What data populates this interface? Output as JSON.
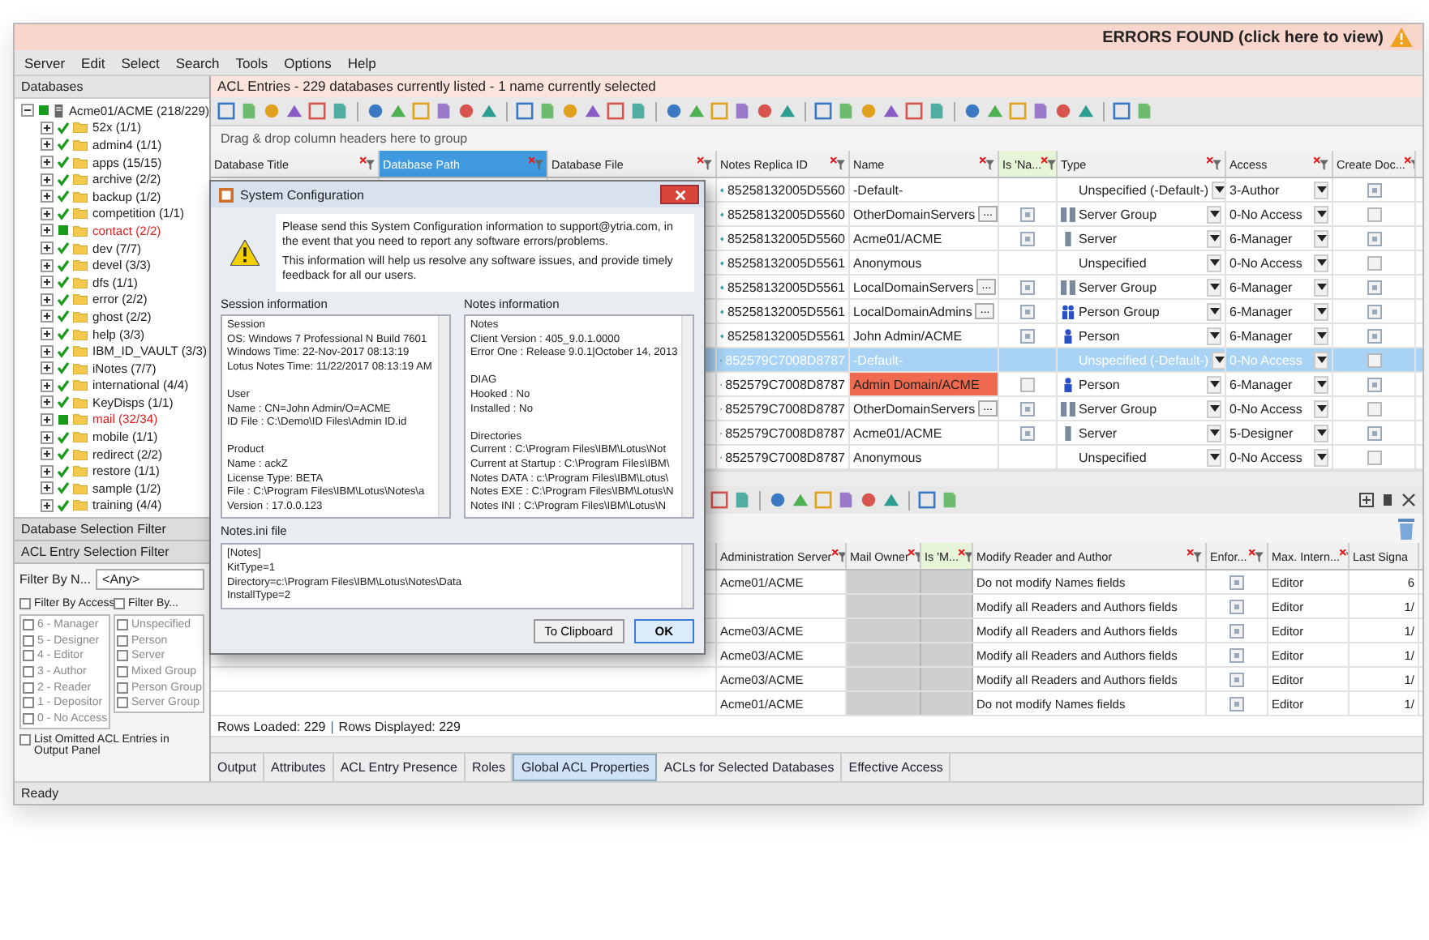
{
  "banner": {
    "text": "ERRORS FOUND (click here to view)"
  },
  "menu": [
    "Server",
    "Edit",
    "Select",
    "Search",
    "Tools",
    "Options",
    "Help"
  ],
  "databases_panel": {
    "title": "Databases",
    "tree": [
      {
        "label": "Acme01/ACME (218/229)",
        "checked": true,
        "partial": true,
        "error": false,
        "expanded": true,
        "children": [
          {
            "label": "52x (1/1)",
            "checked": true,
            "partial": false,
            "error": false,
            "expanded": false
          },
          {
            "label": "admin4 (1/1)",
            "checked": true,
            "partial": false,
            "error": false,
            "expanded": false
          },
          {
            "label": "apps (15/15)",
            "checked": true,
            "partial": false,
            "error": false,
            "expanded": false
          },
          {
            "label": "archive (2/2)",
            "checked": true,
            "partial": false,
            "error": false,
            "expanded": false
          },
          {
            "label": "backup (1/2)",
            "checked": true,
            "partial": false,
            "error": false,
            "expanded": false
          },
          {
            "label": "competition (1/1)",
            "checked": true,
            "partial": false,
            "error": false,
            "expanded": false
          },
          {
            "label": "contact (2/2)",
            "checked": true,
            "partial": true,
            "error": true,
            "expanded": false
          },
          {
            "label": "dev (7/7)",
            "checked": true,
            "partial": false,
            "error": false,
            "expanded": false
          },
          {
            "label": "devel (3/3)",
            "checked": true,
            "partial": false,
            "error": false,
            "expanded": false
          },
          {
            "label": "dfs (1/1)",
            "checked": true,
            "partial": false,
            "error": false,
            "expanded": false
          },
          {
            "label": "error (2/2)",
            "checked": true,
            "partial": false,
            "error": false,
            "expanded": false
          },
          {
            "label": "ghost (2/2)",
            "checked": true,
            "partial": false,
            "error": false,
            "expanded": false
          },
          {
            "label": "help (3/3)",
            "checked": true,
            "partial": false,
            "error": false,
            "expanded": false
          },
          {
            "label": "IBM_ID_VAULT (3/3)",
            "checked": true,
            "partial": false,
            "error": false,
            "expanded": false
          },
          {
            "label": "iNotes (7/7)",
            "checked": true,
            "partial": false,
            "error": false,
            "expanded": false
          },
          {
            "label": "international (4/4)",
            "checked": true,
            "partial": false,
            "error": false,
            "expanded": false
          },
          {
            "label": "KeyDisps (1/1)",
            "checked": true,
            "partial": false,
            "error": false,
            "expanded": false
          },
          {
            "label": "mail (32/34)",
            "checked": true,
            "partial": true,
            "error": true,
            "expanded": false
          },
          {
            "label": "mobile (1/1)",
            "checked": true,
            "partial": false,
            "error": false,
            "expanded": false
          },
          {
            "label": "redirect (2/2)",
            "checked": true,
            "partial": false,
            "error": false,
            "expanded": false
          },
          {
            "label": "restore (1/1)",
            "checked": true,
            "partial": false,
            "error": false,
            "expanded": false
          },
          {
            "label": "sample (1/2)",
            "checked": true,
            "partial": false,
            "error": false,
            "expanded": false
          },
          {
            "label": "training (4/4)",
            "checked": true,
            "partial": false,
            "error": false,
            "expanded": false
          }
        ]
      }
    ]
  },
  "filters": {
    "database_filter": "Database Selection Filter",
    "acl_filter": "ACL Entry Selection Filter",
    "filter_by_name": {
      "label": "Filter By N...",
      "value": "<Any>"
    },
    "access_filter": {
      "label": "Filter By Access",
      "checked": false,
      "options": [
        {
          "label": "6 - Manager",
          "checked": false
        },
        {
          "label": "5 - Designer",
          "checked": false
        },
        {
          "label": "4 - Editor",
          "checked": false
        },
        {
          "label": "3 - Author",
          "checked": false
        },
        {
          "label": "2 - Reader",
          "checked": false
        },
        {
          "label": "1 - Depositor",
          "checked": false
        },
        {
          "label": "0 - No Access",
          "checked": false
        }
      ]
    },
    "type_filter": {
      "label": "Filter By...",
      "checked": false,
      "options": [
        {
          "label": "Unspecified",
          "checked": false
        },
        {
          "label": "Person",
          "checked": false
        },
        {
          "label": "Server",
          "checked": false
        },
        {
          "label": "Mixed Group",
          "checked": false
        },
        {
          "label": "Person Group",
          "checked": false
        },
        {
          "label": "Server Group",
          "checked": false
        }
      ]
    },
    "list_omitted": {
      "label": "List Omitted ACL Entries in Output Panel",
      "checked": false
    }
  },
  "acl_panel": {
    "title": "ACL Entries - 229 databases currently listed - 1 name currently selected",
    "group_hint": "Drag & drop column headers here to group",
    "upper_table": {
      "columns": [
        {
          "label": "Database Title",
          "selected": false,
          "tinted": false
        },
        {
          "label": "Database Path",
          "selected": true,
          "tinted": false
        },
        {
          "label": "Database File",
          "selected": false,
          "tinted": false
        },
        {
          "label": "Notes Replica ID",
          "selected": false,
          "tinted": false
        },
        {
          "label": "Name",
          "selected": false,
          "tinted": false
        },
        {
          "label": "Is 'Na...",
          "selected": false,
          "tinted": true
        },
        {
          "label": "Type",
          "selected": false,
          "tinted": false
        },
        {
          "label": "Access",
          "selected": false,
          "tinted": false
        },
        {
          "label": "Create Doc...",
          "selected": false,
          "tinted": false
        }
      ],
      "rows": [
        {
          "replica_id": "85258132005D5560",
          "name": "-Default-",
          "name_error": false,
          "type": "Unspecified (-Default-)",
          "kind": "none",
          "access": "3-Author",
          "create_documents": true,
          "selected": false
        },
        {
          "replica_id": "85258132005D5560",
          "name": "OtherDomainServers",
          "name_error": false,
          "members_button": "...",
          "names_check": true,
          "type": "Server Group",
          "kind": "server-group",
          "access": "0-No Access",
          "create_documents": false,
          "selected": false
        },
        {
          "replica_id": "85258132005D5560",
          "name": "Acme01/ACME",
          "name_error": false,
          "names_check": true,
          "type": "Server",
          "kind": "server",
          "access": "6-Manager",
          "create_documents": true,
          "selected": false
        },
        {
          "replica_id": "85258132005D5561",
          "name": "Anonymous",
          "name_error": false,
          "type": "Unspecified",
          "kind": "none",
          "access": "0-No Access",
          "create_documents": false,
          "selected": false
        },
        {
          "replica_id": "85258132005D5561",
          "name": "LocalDomainServers",
          "name_error": false,
          "members_button": "...",
          "names_check": true,
          "type": "Server Group",
          "kind": "server-group",
          "access": "6-Manager",
          "create_documents": true,
          "selected": false
        },
        {
          "replica_id": "85258132005D5561",
          "name": "LocalDomainAdmins",
          "name_error": false,
          "members_button": "...",
          "names_check": true,
          "type": "Person Group",
          "kind": "person-group",
          "access": "6-Manager",
          "create_documents": true,
          "selected": false
        },
        {
          "replica_id": "85258132005D5561",
          "name": "John Admin/ACME",
          "name_error": false,
          "names_check": true,
          "type": "Person",
          "kind": "person",
          "access": "6-Manager",
          "create_documents": true,
          "selected": false
        },
        {
          "replica_id": "852579C7008D8787",
          "name": "-Default-",
          "name_error": false,
          "type": "Unspecified (-Default-)",
          "kind": "none",
          "access": "0-No Access",
          "create_documents": false,
          "selected": true
        },
        {
          "replica_id": "852579C7008D8787",
          "name": "Admin Domain/ACME",
          "name_error": true,
          "names_check": false,
          "type": "Person",
          "kind": "person",
          "access": "6-Manager",
          "create_documents": true,
          "selected": false
        },
        {
          "replica_id": "852579C7008D8787",
          "name": "OtherDomainServers",
          "name_error": false,
          "members_button": "...",
          "names_check": true,
          "type": "Server Group",
          "kind": "server-group",
          "access": "0-No Access",
          "create_documents": false,
          "selected": false
        },
        {
          "replica_id": "852579C7008D8787",
          "name": "Acme01/ACME",
          "name_error": false,
          "names_check": true,
          "type": "Server",
          "kind": "server",
          "access": "5-Designer",
          "create_documents": true,
          "selected": false
        },
        {
          "replica_id": "852579C7008D8787",
          "name": "Anonymous",
          "name_error": false,
          "type": "Unspecified",
          "kind": "none",
          "access": "0-No Access",
          "create_documents": false,
          "selected": false
        }
      ]
    },
    "lower_table": {
      "columns": [
        "Administration Server",
        "Mail Owner",
        "Is 'M...",
        "Modify Reader and Author",
        "Enfor...",
        "Max. Intern...",
        "Last Signa"
      ],
      "rows": [
        {
          "admin_server": "Acme01/ACME",
          "modify": "Do not modify Names fields",
          "enforce": true,
          "max_internet": "Editor",
          "last_signature": "6"
        },
        {
          "modify": "Modify all Readers and Authors fields",
          "enforce": true,
          "max_internet": "Editor",
          "last_signature": "1/"
        },
        {
          "admin_server": "Acme03/ACME",
          "modify": "Modify all Readers and Authors fields",
          "enforce": true,
          "max_internet": "Editor",
          "last_signature": "1/"
        },
        {
          "admin_server": "Acme03/ACME",
          "modify": "Modify all Readers and Authors fields",
          "enforce": true,
          "max_internet": "Editor",
          "last_signature": "1/"
        },
        {
          "admin_server": "Acme03/ACME",
          "modify": "Modify all Readers and Authors fields",
          "enforce": true,
          "max_internet": "Editor",
          "last_signature": "1/"
        },
        {
          "admin_server": "Acme01/ACME",
          "modify": "Do not modify Names fields",
          "enforce": true,
          "max_internet": "Editor",
          "last_signature": "1/"
        }
      ]
    },
    "row_counts": {
      "loaded": "Rows Loaded: 229",
      "separator": "|",
      "displayed": "Rows Displayed: 229"
    },
    "tabs": [
      {
        "label": "Output",
        "selected": false
      },
      {
        "label": "Attributes",
        "selected": false
      },
      {
        "label": "ACL Entry Presence",
        "selected": false
      },
      {
        "label": "Roles",
        "selected": false
      },
      {
        "label": "Global ACL Properties",
        "selected": true
      },
      {
        "label": "ACLs for Selected Databases",
        "selected": false
      },
      {
        "label": "Effective Access",
        "selected": false
      }
    ]
  },
  "dialog": {
    "title": "System Configuration",
    "message": [
      "Please send this System Configuration information to support@ytria.com, in the event that you need to report any software errors/problems.",
      "This information will help us resolve any software issues, and provide timely feedback for all our users."
    ],
    "session": {
      "label": "Session information",
      "sections": [
        [
          "Session",
          "OS: Windows 7 Professional N Build 7601",
          "Windows Time: 22-Nov-2017 08:13:19",
          "Lotus Notes Time: 11/22/2017 08:13:19 AM"
        ],
        [
          "User",
          "Name : CN=John Admin/O=ACME",
          "ID File : C:\\Demo\\ID Files\\Admin ID.id"
        ],
        [
          "Product",
          "Name : ackZ",
          "License Type: BETA",
          "File : C:\\Program Files\\IBM\\Lotus\\Notes\\a",
          "Version : 17.0.0.123"
        ]
      ]
    },
    "notes": {
      "label": "Notes information",
      "sections": [
        [
          "Notes",
          "Client Version : 405_9.0.1.0000",
          "Error One : Release 9.0.1|October 14, 2013"
        ],
        [
          "DIAG",
          "Hooked : No",
          "Installed : No"
        ],
        [
          "Directories",
          "Current : C:\\Program Files\\IBM\\Lotus\\Not",
          "Current at Startup : C:\\Program Files\\IBM\\",
          "Notes DATA : c:\\Program Files\\IBM\\Lotus\\",
          "Notes EXE : C:\\Program Files\\IBM\\Lotus\\N",
          "Notes INI : C:\\Program Files\\IBM\\Lotus\\N"
        ]
      ]
    },
    "ini": {
      "label": "Notes.ini file",
      "lines": [
        "[Notes]",
        "KitType=1",
        "Directory=c:\\Program Files\\IBM\\Lotus\\Notes\\Data",
        "InstallType=2"
      ]
    },
    "buttons": {
      "clipboard": "To Clipboard",
      "ok": "OK"
    }
  },
  "status_bar": "Ready"
}
